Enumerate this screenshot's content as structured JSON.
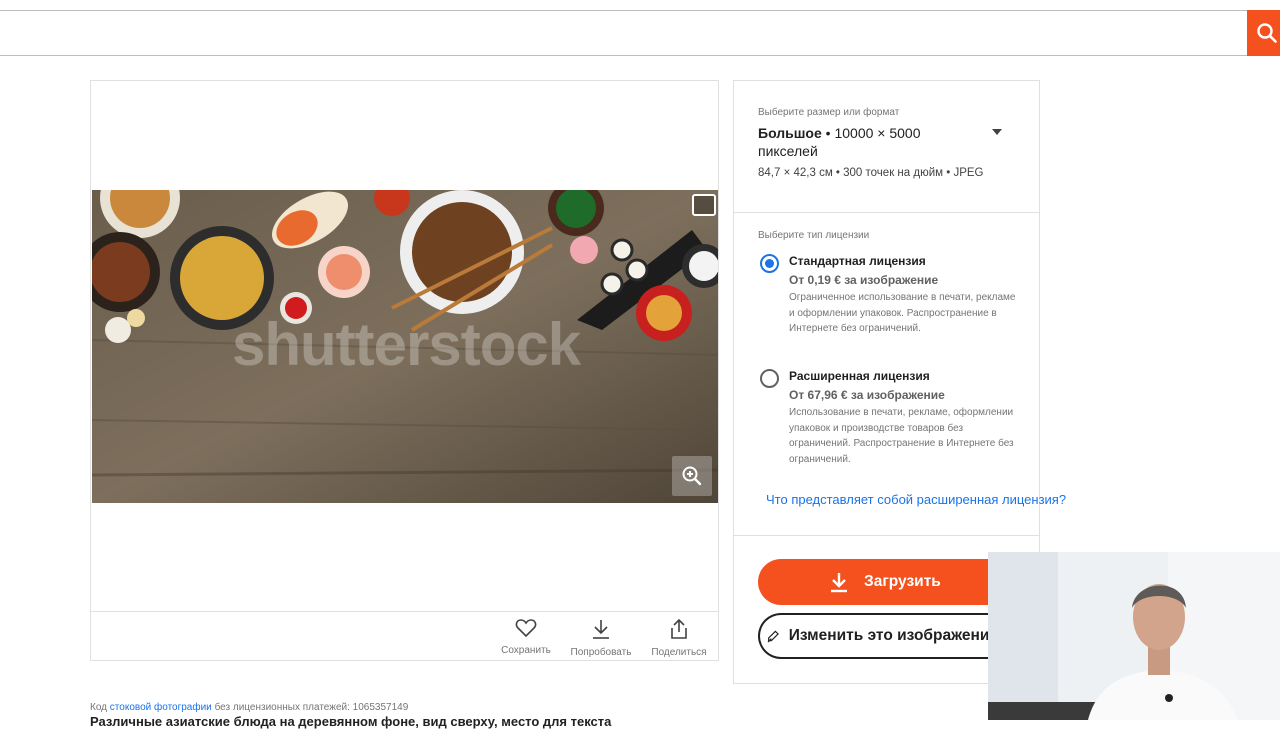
{
  "search": {
    "placeholder": ""
  },
  "image": {
    "watermark": "shutterstock",
    "actions": [
      {
        "label": "Сохранить",
        "icon": "heart-icon"
      },
      {
        "label": "Попробовать",
        "icon": "download-icon"
      },
      {
        "label": "Поделиться",
        "icon": "share-icon"
      }
    ]
  },
  "license": {
    "size_label": "Выберите размер или формат",
    "size_name": "Большое",
    "size_value": "10000 × 5000 пикселей",
    "size_details": "84,7 × 42,3 см • 300 точек на дюйм • JPEG",
    "type_label": "Выберите тип лицензии",
    "options": [
      {
        "title": "Стандартная лицензия",
        "price": "От 0,19 € за изображение",
        "desc": "Ограниченное использование в печати, рекламе и оформлении упаковок. Распространение в Интернете без ограничений.",
        "selected": true
      },
      {
        "title": "Расширенная лицензия",
        "price": "От 67,96 € за изображение",
        "desc": "Использование в печати, рекламе, оформлении упаковок и производстве товаров без ограничений. Распространение в Интернете без ограничений.",
        "selected": false
      }
    ],
    "link": "Что представляет собой расширенная лицензия?",
    "download_label": "Загрузить",
    "edit_label": "Изменить это изображение"
  },
  "footer": {
    "code_prefix": "Код",
    "code_link": "стоковой фотографии",
    "code_suffix": "без лицензионных платежей: 1065357149",
    "title": "Различные азиатские блюда на деревянном фоне, вид сверху, место для текста"
  },
  "colors": {
    "accent": "#f4511e",
    "link": "#1a73e8",
    "radio": "#1a73e8"
  }
}
